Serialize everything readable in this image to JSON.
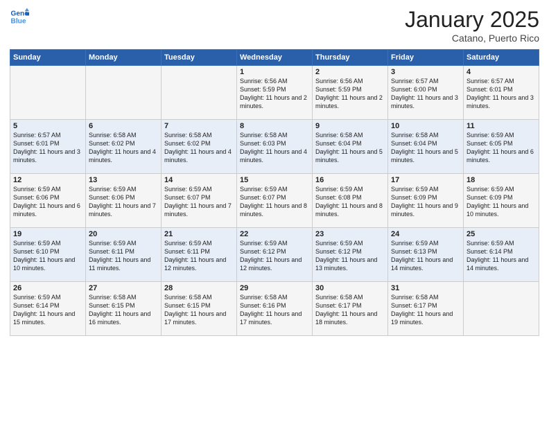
{
  "header": {
    "logo_line1": "General",
    "logo_line2": "Blue",
    "month": "January 2025",
    "location": "Catano, Puerto Rico"
  },
  "weekdays": [
    "Sunday",
    "Monday",
    "Tuesday",
    "Wednesday",
    "Thursday",
    "Friday",
    "Saturday"
  ],
  "weeks": [
    [
      {
        "day": "",
        "info": ""
      },
      {
        "day": "",
        "info": ""
      },
      {
        "day": "",
        "info": ""
      },
      {
        "day": "1",
        "info": "Sunrise: 6:56 AM\nSunset: 5:59 PM\nDaylight: 11 hours and 2 minutes."
      },
      {
        "day": "2",
        "info": "Sunrise: 6:56 AM\nSunset: 5:59 PM\nDaylight: 11 hours and 2 minutes."
      },
      {
        "day": "3",
        "info": "Sunrise: 6:57 AM\nSunset: 6:00 PM\nDaylight: 11 hours and 3 minutes."
      },
      {
        "day": "4",
        "info": "Sunrise: 6:57 AM\nSunset: 6:01 PM\nDaylight: 11 hours and 3 minutes."
      }
    ],
    [
      {
        "day": "5",
        "info": "Sunrise: 6:57 AM\nSunset: 6:01 PM\nDaylight: 11 hours and 3 minutes."
      },
      {
        "day": "6",
        "info": "Sunrise: 6:58 AM\nSunset: 6:02 PM\nDaylight: 11 hours and 4 minutes."
      },
      {
        "day": "7",
        "info": "Sunrise: 6:58 AM\nSunset: 6:02 PM\nDaylight: 11 hours and 4 minutes."
      },
      {
        "day": "8",
        "info": "Sunrise: 6:58 AM\nSunset: 6:03 PM\nDaylight: 11 hours and 4 minutes."
      },
      {
        "day": "9",
        "info": "Sunrise: 6:58 AM\nSunset: 6:04 PM\nDaylight: 11 hours and 5 minutes."
      },
      {
        "day": "10",
        "info": "Sunrise: 6:58 AM\nSunset: 6:04 PM\nDaylight: 11 hours and 5 minutes."
      },
      {
        "day": "11",
        "info": "Sunrise: 6:59 AM\nSunset: 6:05 PM\nDaylight: 11 hours and 6 minutes."
      }
    ],
    [
      {
        "day": "12",
        "info": "Sunrise: 6:59 AM\nSunset: 6:06 PM\nDaylight: 11 hours and 6 minutes."
      },
      {
        "day": "13",
        "info": "Sunrise: 6:59 AM\nSunset: 6:06 PM\nDaylight: 11 hours and 7 minutes."
      },
      {
        "day": "14",
        "info": "Sunrise: 6:59 AM\nSunset: 6:07 PM\nDaylight: 11 hours and 7 minutes."
      },
      {
        "day": "15",
        "info": "Sunrise: 6:59 AM\nSunset: 6:07 PM\nDaylight: 11 hours and 8 minutes."
      },
      {
        "day": "16",
        "info": "Sunrise: 6:59 AM\nSunset: 6:08 PM\nDaylight: 11 hours and 8 minutes."
      },
      {
        "day": "17",
        "info": "Sunrise: 6:59 AM\nSunset: 6:09 PM\nDaylight: 11 hours and 9 minutes."
      },
      {
        "day": "18",
        "info": "Sunrise: 6:59 AM\nSunset: 6:09 PM\nDaylight: 11 hours and 10 minutes."
      }
    ],
    [
      {
        "day": "19",
        "info": "Sunrise: 6:59 AM\nSunset: 6:10 PM\nDaylight: 11 hours and 10 minutes."
      },
      {
        "day": "20",
        "info": "Sunrise: 6:59 AM\nSunset: 6:11 PM\nDaylight: 11 hours and 11 minutes."
      },
      {
        "day": "21",
        "info": "Sunrise: 6:59 AM\nSunset: 6:11 PM\nDaylight: 11 hours and 12 minutes."
      },
      {
        "day": "22",
        "info": "Sunrise: 6:59 AM\nSunset: 6:12 PM\nDaylight: 11 hours and 12 minutes."
      },
      {
        "day": "23",
        "info": "Sunrise: 6:59 AM\nSunset: 6:12 PM\nDaylight: 11 hours and 13 minutes."
      },
      {
        "day": "24",
        "info": "Sunrise: 6:59 AM\nSunset: 6:13 PM\nDaylight: 11 hours and 14 minutes."
      },
      {
        "day": "25",
        "info": "Sunrise: 6:59 AM\nSunset: 6:14 PM\nDaylight: 11 hours and 14 minutes."
      }
    ],
    [
      {
        "day": "26",
        "info": "Sunrise: 6:59 AM\nSunset: 6:14 PM\nDaylight: 11 hours and 15 minutes."
      },
      {
        "day": "27",
        "info": "Sunrise: 6:58 AM\nSunset: 6:15 PM\nDaylight: 11 hours and 16 minutes."
      },
      {
        "day": "28",
        "info": "Sunrise: 6:58 AM\nSunset: 6:15 PM\nDaylight: 11 hours and 17 minutes."
      },
      {
        "day": "29",
        "info": "Sunrise: 6:58 AM\nSunset: 6:16 PM\nDaylight: 11 hours and 17 minutes."
      },
      {
        "day": "30",
        "info": "Sunrise: 6:58 AM\nSunset: 6:17 PM\nDaylight: 11 hours and 18 minutes."
      },
      {
        "day": "31",
        "info": "Sunrise: 6:58 AM\nSunset: 6:17 PM\nDaylight: 11 hours and 19 minutes."
      },
      {
        "day": "",
        "info": ""
      }
    ]
  ]
}
